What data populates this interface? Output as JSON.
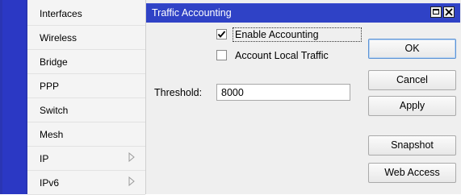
{
  "menu": {
    "items": [
      {
        "label": "Interfaces",
        "submenu": false
      },
      {
        "label": "Wireless",
        "submenu": false
      },
      {
        "label": "Bridge",
        "submenu": false
      },
      {
        "label": "PPP",
        "submenu": false
      },
      {
        "label": "Switch",
        "submenu": false
      },
      {
        "label": "Mesh",
        "submenu": false
      },
      {
        "label": "IP",
        "submenu": true
      },
      {
        "label": "IPv6",
        "submenu": true
      }
    ]
  },
  "dialog": {
    "title": "Traffic Accounting",
    "enable_accounting": {
      "label": "Enable Accounting",
      "checked": true
    },
    "account_local_traffic": {
      "label": "Account Local Traffic",
      "checked": false
    },
    "threshold": {
      "label": "Threshold:",
      "value": "8000"
    },
    "buttons": {
      "ok": "OK",
      "cancel": "Cancel",
      "apply": "Apply",
      "snapshot": "Snapshot",
      "web_access": "Web Access"
    }
  },
  "colors": {
    "sidebar_blue": "#2b38c4",
    "titlebar_blue": "#2f42c6"
  }
}
